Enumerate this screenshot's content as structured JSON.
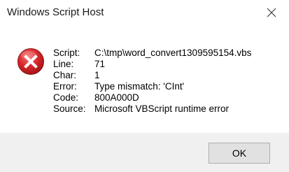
{
  "window": {
    "title": "Windows Script Host",
    "close_icon": "close-icon"
  },
  "message": {
    "icon": "error-icon",
    "rows": [
      {
        "label": "Script:",
        "value": "C:\\tmp\\word_convert1309595154.vbs"
      },
      {
        "label": "Line:",
        "value": "71"
      },
      {
        "label": "Char:",
        "value": "1"
      },
      {
        "label": "Error:",
        "value": "Type mismatch: 'CInt'"
      },
      {
        "label": "Code:",
        "value": "800A000D"
      },
      {
        "label": "Source:",
        "value": "Microsoft VBScript runtime error"
      }
    ]
  },
  "buttons": {
    "ok_label": "OK"
  },
  "colors": {
    "error_red": "#d9262b",
    "footer_bg": "#f0f0f0"
  }
}
